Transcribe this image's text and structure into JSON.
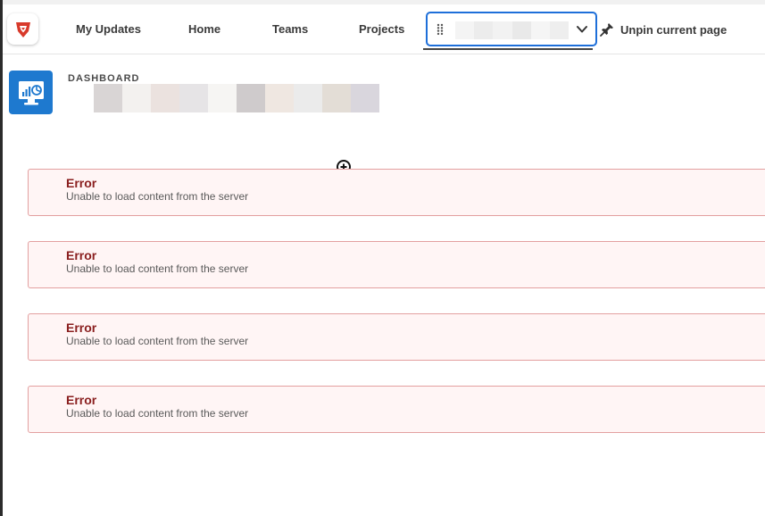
{
  "nav": {
    "items": [
      {
        "label": "My Updates"
      },
      {
        "label": "Home"
      },
      {
        "label": "Teams"
      },
      {
        "label": "Projects"
      }
    ],
    "pinned_select": {
      "value": ""
    },
    "unpin_label": "Unpin current page"
  },
  "header": {
    "section_label": "DASHBOARD",
    "dashboard_name": ""
  },
  "errors": [
    {
      "title": "Error",
      "message": "Unable to load content from the server"
    },
    {
      "title": "Error",
      "message": "Unable to load content from the server"
    },
    {
      "title": "Error",
      "message": "Unable to load content from the server"
    },
    {
      "title": "Error",
      "message": "Unable to load content from the server"
    }
  ],
  "colors": {
    "accent": "#1e6fd9",
    "brand_red": "#d83a2b",
    "dashboard_icon_bg": "#1e79cf",
    "error_title": "#8a1f1f",
    "error_border": "#e3a0a0",
    "error_bg": "#fff5f5"
  },
  "icons": {
    "logo": "app-logo-icon",
    "drag": "drag-handle-icon",
    "dropdown": "chevron-down-icon",
    "unpin": "pin-icon",
    "dashboard": "dashboard-monitor-icon",
    "cursor": "zoom-in-cursor-icon"
  }
}
